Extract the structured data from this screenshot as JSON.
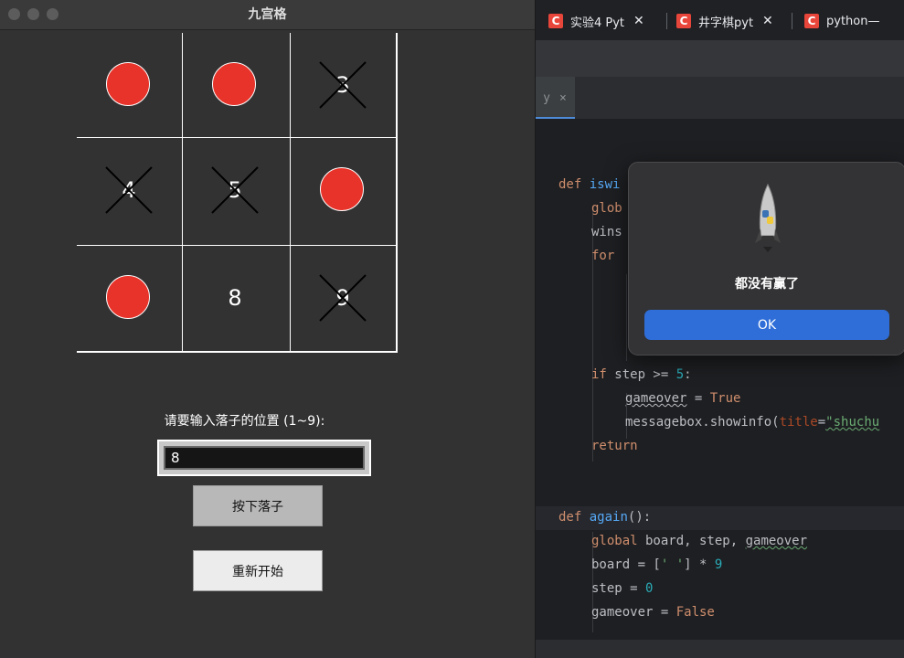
{
  "browser": {
    "tabs": [
      {
        "favicon": "C",
        "title": "实验4 Pyt"
      },
      {
        "favicon": "C",
        "title": "井字棋pyt"
      },
      {
        "favicon": "C",
        "title": "python—"
      }
    ],
    "close_glyph": "✕"
  },
  "ide": {
    "tab_label": "y",
    "tab_close": "×",
    "code": {
      "l1_def": "def",
      "l1_fn": "iswi",
      "l2": "glob",
      "l3": "wins",
      "l4_kw": "for",
      "l8_kw": "if",
      "l8_rest": " step >= ",
      "l8_num": "5",
      "l8_end": ":",
      "l9_a": "gameover",
      "l9_b": " = ",
      "l9_c": "True",
      "l10_a": "messagebox.showinfo(",
      "l10_prm": "title",
      "l10_eq": "=",
      "l10_str": "\"shuchu",
      "l11": "return",
      "l12_def": "def",
      "l12_fn": "again",
      "l12_end": "():",
      "l13_kw": "global",
      "l13_a": " board, step, ",
      "l13_b": "gameover",
      "l14_a": "board = [",
      "l14_str": "' '",
      "l14_b": "] * ",
      "l14_num": "9",
      "l15_a": "step = ",
      "l15_num": "0",
      "l16_a": "gameover = ",
      "l16_kw": "False"
    }
  },
  "tk": {
    "title": "九宫格",
    "cells": [
      {
        "mark": "O",
        "label": ""
      },
      {
        "mark": "O",
        "label": ""
      },
      {
        "mark": "X",
        "label": "3"
      },
      {
        "mark": "X",
        "label": "4"
      },
      {
        "mark": "X",
        "label": "5"
      },
      {
        "mark": "O",
        "label": ""
      },
      {
        "mark": "O",
        "label": ""
      },
      {
        "mark": "",
        "label": "8"
      },
      {
        "mark": "X",
        "label": "9"
      }
    ],
    "prompt": "请要输入落子的位置 (1~9):",
    "input_value": "8",
    "place_button": "按下落子",
    "restart_button": "重新开始",
    "colors": {
      "circle": "#e8332a",
      "background": "#323232"
    }
  },
  "dialog": {
    "icon": "python-rocket-icon",
    "message": "都没有赢了",
    "ok": "OK"
  }
}
